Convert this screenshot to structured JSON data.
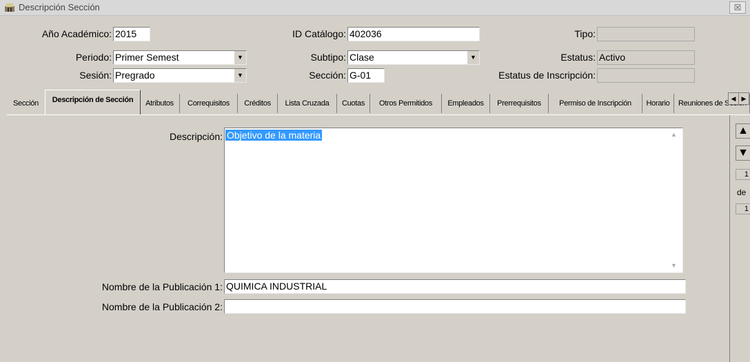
{
  "window": {
    "title": "Descripción Sección",
    "close_label": "☒"
  },
  "header": {
    "anio_label": "Año Académico:",
    "anio_value": "2015",
    "periodo_label": "Periodo:",
    "periodo_value": "Primer Semest",
    "sesion_label": "Sesión:",
    "sesion_value": "Pregrado",
    "catalogo_label": "ID Catálogo:",
    "catalogo_value": "402036",
    "subtipo_label": "Subtipo:",
    "subtipo_value": "Clase",
    "seccion_label": "Sección:",
    "seccion_value": "G-01",
    "tipo_label": "Tipo:",
    "tipo_value": "",
    "estatus_label": "Estatus:",
    "estatus_value": "Activo",
    "estatus_insc_label": "Estatus de Inscripción:",
    "estatus_insc_value": ""
  },
  "tabs": [
    "Sección",
    "Descripción de Sección",
    "Atributos",
    "Correquisitos",
    "Créditos",
    "Lista Cruzada",
    "Cuotas",
    "Otros Permitidos",
    "Empleados",
    "Prerrequisitos",
    "Permiso de Inscripción",
    "Horario",
    "Reuniones de Sesión"
  ],
  "active_tab": "Descripción de Sección",
  "form": {
    "descripcion_label": "Descripción:",
    "descripcion_value": "Objetivo de la  materia",
    "pub1_label": "Nombre de la Publicación 1:",
    "pub1_value": "QUIMICA INDUSTRIAL",
    "pub2_label": "Nombre de la Publicación 2:",
    "pub2_value": ""
  },
  "record_nav": {
    "current": "1",
    "de_label": "de",
    "total": "1"
  },
  "colors": {
    "selection": "#3399ff",
    "window_bg": "#d4d0c8"
  }
}
